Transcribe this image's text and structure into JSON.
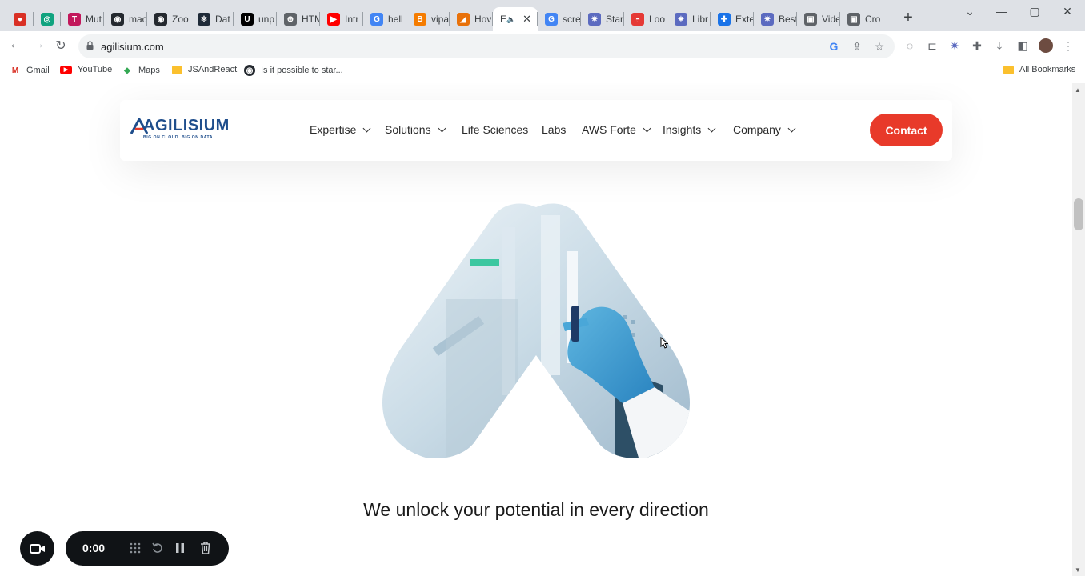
{
  "browser": {
    "tabs": [
      {
        "title": "",
        "fav_color": "#d93025",
        "fav_glyph": "●"
      },
      {
        "title": "",
        "fav_color": "#10a37f",
        "fav_glyph": "◎"
      },
      {
        "title": "Mut",
        "fav_color": "#c2185b",
        "fav_glyph": "T"
      },
      {
        "title": "mac",
        "fav_color": "#24292f",
        "fav_glyph": "◉"
      },
      {
        "title": "Zoo",
        "fav_color": "#24292f",
        "fav_glyph": "◉"
      },
      {
        "title": "Dat",
        "fav_color": "#1e2a38",
        "fav_glyph": "⚛"
      },
      {
        "title": "unp",
        "fav_color": "#000000",
        "fav_glyph": "U"
      },
      {
        "title": "HTM",
        "fav_color": "#5f6368",
        "fav_glyph": "⊕"
      },
      {
        "title": "Intr",
        "fav_color": "#ff0000",
        "fav_glyph": "▶"
      },
      {
        "title": "hell",
        "fav_color": "#4285f4",
        "fav_glyph": "G"
      },
      {
        "title": "vipa",
        "fav_color": "#f57c00",
        "fav_glyph": "B"
      },
      {
        "title": "Hov",
        "fav_color": "#e8710a",
        "fav_glyph": "◢"
      },
      {
        "title": "E",
        "fav_color": "#ffffff",
        "fav_glyph": ""
      },
      {
        "title": "scre",
        "fav_color": "#4285f4",
        "fav_glyph": "G"
      },
      {
        "title": "Star",
        "fav_color": "#5c6bc0",
        "fav_glyph": "✷"
      },
      {
        "title": "Loo",
        "fav_color": "#e53935",
        "fav_glyph": "◓"
      },
      {
        "title": "Libr",
        "fav_color": "#5c6bc0",
        "fav_glyph": "✷"
      },
      {
        "title": "Exte",
        "fav_color": "#1a73e8",
        "fav_glyph": "✚"
      },
      {
        "title": "Best",
        "fav_color": "#5c6bc0",
        "fav_glyph": "✷"
      },
      {
        "title": "Vide",
        "fav_color": "#5f6368",
        "fav_glyph": "▣"
      },
      {
        "title": "Cro",
        "fav_color": "#5f6368",
        "fav_glyph": "▣"
      }
    ],
    "active_tab_index": 12,
    "url": "agilisium.com",
    "bookmarks": [
      {
        "label": "Gmail",
        "icon": "gmail-icon",
        "color": "#d93025",
        "glyph": "M"
      },
      {
        "label": "YouTube",
        "icon": "youtube-icon",
        "color": "#ff0000",
        "glyph": "▶"
      },
      {
        "label": "Maps",
        "icon": "maps-icon",
        "color": "#34a853",
        "glyph": "◆"
      },
      {
        "label": "JSAndReact",
        "icon": "folder-icon",
        "color": "#fbc02d",
        "glyph": ""
      },
      {
        "label": "Is it possible to star...",
        "icon": "github-icon",
        "color": "#24292f",
        "glyph": "◉"
      }
    ],
    "all_bookmarks_label": "All Bookmarks"
  },
  "site": {
    "brand_color": "#1f4e8c",
    "accent_color": "#e83a2a",
    "logo": {
      "name": "AGILISIUM",
      "tagline": "BIG ON CLOUD. BIG ON DATA."
    },
    "nav": [
      {
        "label": "Expertise",
        "dropdown": true
      },
      {
        "label": "Solutions",
        "dropdown": true
      },
      {
        "label": "Life Sciences",
        "dropdown": false
      },
      {
        "label": "Labs",
        "dropdown": false
      },
      {
        "label": "AWS Forte",
        "dropdown": true
      },
      {
        "label": "Insights",
        "dropdown": true
      },
      {
        "label": "Company",
        "dropdown": true
      }
    ],
    "contact_label": "Contact",
    "hero_image_subject": "gloved hand in laboratory, heart-shaped crop",
    "headline": "We unlock your potential in every direction"
  },
  "recorder": {
    "time": "0:00",
    "icons": [
      "camera-icon",
      "grid-icon",
      "restart-icon",
      "pause-icon",
      "trash-icon"
    ]
  }
}
